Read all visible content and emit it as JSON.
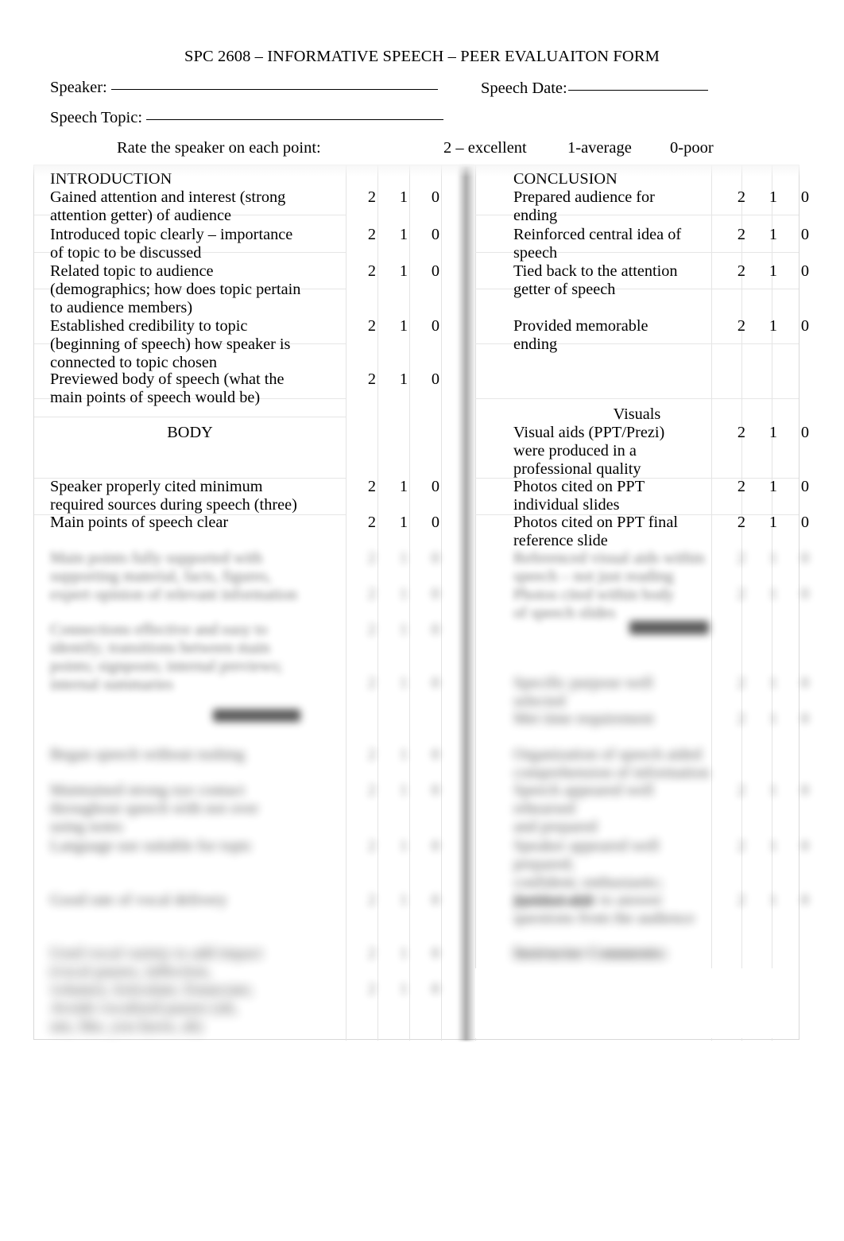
{
  "document": {
    "title": "SPC 2608 – INFORMATIVE SPEECH – PEER EVALUAITON FORM",
    "fields": {
      "speaker_label": "Speaker:",
      "speech_date_label": "Speech Date:",
      "speech_topic_label": "Speech Topic:",
      "speaker_value": "",
      "speech_date_value": "",
      "speech_topic_value": ""
    },
    "rating_instructions": {
      "prompt": "Rate the speaker on each point:",
      "excellent": "2 – excellent",
      "average": "1-average",
      "poor": "0-poor"
    },
    "scale": [
      "2",
      "1",
      "0"
    ]
  },
  "sections": {
    "introduction": {
      "heading": "INTRODUCTION",
      "items": [
        {
          "text": "Gained attention and interest (strong\nattention getter) of audience",
          "scores": [
            "2",
            "1",
            "0"
          ]
        },
        {
          "text": "Introduced topic clearly – importance\nof topic to be discussed",
          "scores": [
            "2",
            "1",
            "0"
          ]
        },
        {
          "text": "Related topic to audience\n(demographics; how does topic pertain\nto audience members)",
          "scores": [
            "2",
            "1",
            "0"
          ]
        },
        {
          "text": "Established credibility to topic\n(beginning of speech) how speaker is\nconnected to topic chosen",
          "scores": [
            "2",
            "1",
            "0"
          ]
        },
        {
          "text": "Previewed body of speech (what the\nmain points of speech would be)",
          "scores": [
            "2",
            "1",
            "0"
          ]
        }
      ]
    },
    "body": {
      "heading": "BODY",
      "items": [
        {
          "text": "Speaker properly cited minimum\nrequired sources during speech (three)",
          "scores": [
            "2",
            "1",
            "0"
          ]
        },
        {
          "text": "Main points of speech clear",
          "scores": [
            "2",
            "1",
            "0"
          ]
        }
      ]
    },
    "conclusion": {
      "heading": "CONCLUSION",
      "items": [
        {
          "text": "Prepared audience for\nending",
          "scores": [
            "2",
            "1",
            "0"
          ]
        },
        {
          "text": "Reinforced central idea of\nspeech",
          "scores": [
            "2",
            "1",
            "0"
          ]
        },
        {
          "text": "Tied back to the attention\ngetter of speech",
          "scores": [
            "2",
            "1",
            "0"
          ]
        },
        {
          "text": "Provided memorable\nending",
          "scores": [
            "2",
            "1",
            "0"
          ]
        }
      ]
    },
    "visuals": {
      "heading": "Visuals",
      "items": [
        {
          "text": "Visual aids (PPT/Prezi)\nwere produced in a\nprofessional quality",
          "scores": [
            "2",
            "1",
            "0"
          ]
        },
        {
          "text": "Photos cited on PPT\nindividual slides",
          "scores": [
            "2",
            "1",
            "0"
          ]
        },
        {
          "text": "Photos cited on PPT final\nreference slide",
          "scores": [
            "2",
            "1",
            "0"
          ]
        }
      ]
    }
  },
  "obscured": {
    "note": "Lower portion of the form is blurred and illegible in the screenshot.",
    "left_column": [
      {
        "text": "Main points fully supported with\nsupporting material, facts, figures,\nexpert opinion of relevant information",
        "scores": [
          "2",
          "1",
          "0"
        ]
      },
      {
        "text": "Connections effective and easy to\nidentify; transitions between main\npoints; signposts; internal previews;\ninternal summaries",
        "scores": [
          "2",
          "1",
          "0"
        ]
      },
      {
        "heading": "DELIVERY"
      },
      {
        "text": "Began speech without rushing",
        "scores": [
          "2",
          "1",
          "0"
        ]
      },
      {
        "text": "Maintained strong eye contact\nthroughout speech with not over\nusing notes",
        "scores": [
          "2",
          "1",
          "0"
        ]
      },
      {
        "text": "Language use suitable for topic",
        "scores": [
          "2",
          "1",
          "0"
        ]
      },
      {
        "text": "Good rate of vocal delivery",
        "scores": [
          "2",
          "1",
          "0"
        ]
      },
      {
        "text": "Used vocal variety to add impact\n(vocal pauses, inflection,\nvolume); Articulate; Enunciate;\nAvoids vocalized pauses (uh,\num, like, you know, ah)",
        "scores": [
          "2",
          "1",
          "0"
        ]
      }
    ],
    "right_column": [
      {
        "text": "Referenced visual aids within\nspeech – not just reading\nPhotos cited within body\nof speech slides",
        "scores": [
          "2",
          "1",
          "0"
        ]
      },
      {
        "heading": "OVERALL"
      },
      {
        "text": "Specific purpose well\nselected",
        "scores": [
          "2",
          "1",
          "0"
        ]
      },
      {
        "text": "Met time requirement",
        "scores": [
          "2",
          "1",
          "0"
        ]
      },
      {
        "text": "Organization of speech aided\ncomprehension of information",
        "scores": [
          "2",
          "1",
          "0"
        ]
      },
      {
        "text": "Speech appeared well rehearsed\nand prepared",
        "scores": [
          "2",
          "1",
          "0"
        ]
      },
      {
        "text": "Speaker appeared well prepared;\nconfident; enthusiastic;\nprofessional",
        "scores": [
          "2",
          "1",
          "0"
        ]
      },
      {
        "text": "Speaker able to answer\nquestions from the audience",
        "scores": [
          "2",
          "1",
          "0"
        ]
      },
      {
        "heading": "Instructor Comments:"
      }
    ]
  }
}
